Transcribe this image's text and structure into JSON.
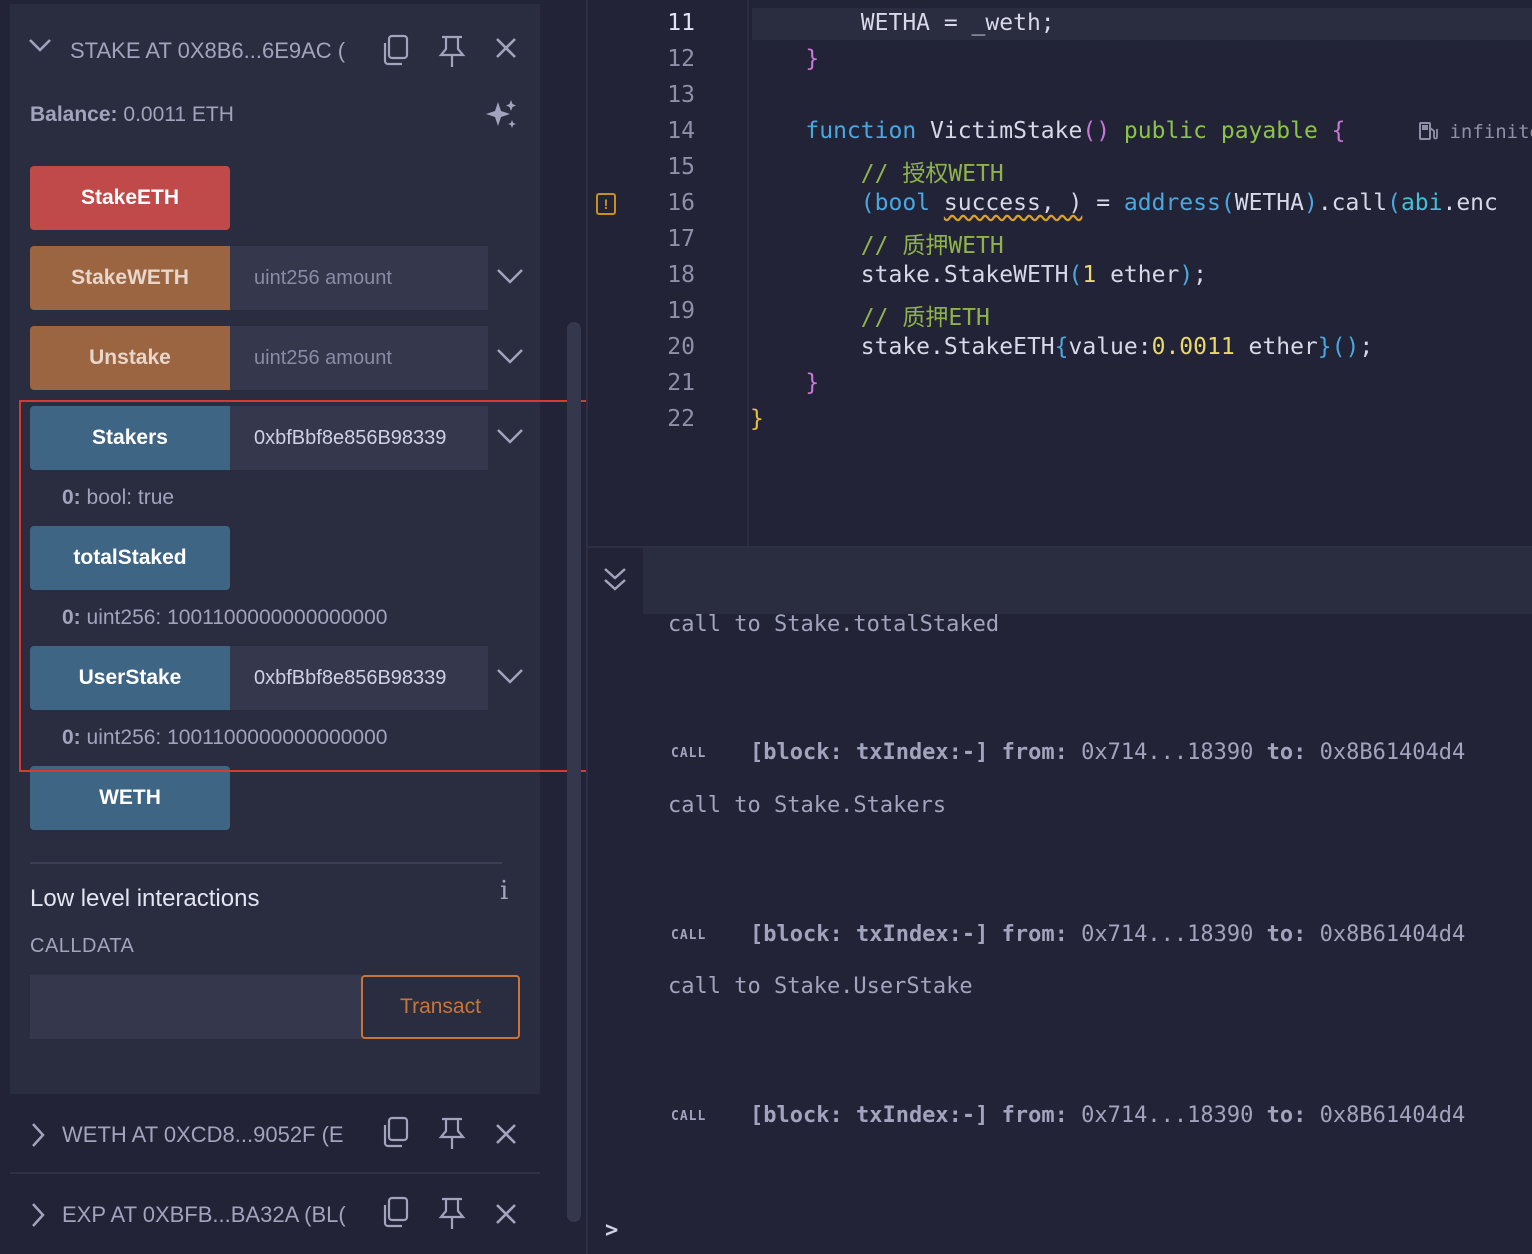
{
  "instances": [
    {
      "title": "STAKE AT 0X8B6...6E9AC (",
      "expanded": true
    },
    {
      "title": "WETH AT 0XCD8...9052F (E",
      "expanded": false
    },
    {
      "title": "EXP AT 0XBFB...BA32A (BL(",
      "expanded": false
    }
  ],
  "balance": {
    "label": "Balance:",
    "value": "0.0011 ETH"
  },
  "functions": {
    "stake_eth": "StakeETH",
    "stake_weth": {
      "label": "StakeWETH",
      "placeholder": "uint256 amount"
    },
    "unstake": {
      "label": "Unstake",
      "placeholder": "uint256 amount"
    },
    "stakers": {
      "label": "Stakers",
      "value": "0xbfBbf8e856B98339",
      "output_key": "0:",
      "output_value": "bool: true"
    },
    "total_staked": {
      "label": "totalStaked",
      "output_key": "0:",
      "output_value": "uint256: 1001100000000000000"
    },
    "user_stake": {
      "label": "UserStake",
      "value": "0xbfBbf8e856B98339",
      "output_key": "0:",
      "output_value": "uint256: 1001100000000000000"
    },
    "weth": "WETH"
  },
  "low_level": {
    "title": "Low level interactions",
    "calldata_label": "CALLDATA",
    "transact_label": "Transact",
    "info_glyph": "i"
  },
  "editor": {
    "line_numbers": [
      "11",
      "12",
      "13",
      "14",
      "15",
      "16",
      "17",
      "18",
      "19",
      "20",
      "21",
      "22"
    ],
    "gas_info": "infinite",
    "comments": {
      "approve": "// 授权WETH",
      "stake_weth": "// 质押WETH",
      "stake_eth": "// 质押ETH"
    }
  },
  "terminal": {
    "calls": [
      {
        "message": "call to Stake.totalStaked"
      },
      {
        "tag": "CALL",
        "log": "[block: txIndex:-] from: 0x714...18390 to: 0x8B61404d4",
        "message": "call to Stake.Stakers"
      },
      {
        "tag": "CALL",
        "log": "[block: txIndex:-] from: 0x714...18390 to: 0x8B61404d4",
        "message": "call to Stake.UserStake"
      },
      {
        "tag": "CALL",
        "log": "[block: txIndex:-] from: 0x714...18390 to: 0x8B61404d4"
      }
    ],
    "prompt": ">"
  },
  "colors": {
    "accent_red": "#c04a49",
    "accent_brown": "#9b6542",
    "accent_blue": "#3f6585",
    "highlight_box": "#d63a30",
    "transact": "#c97539"
  }
}
